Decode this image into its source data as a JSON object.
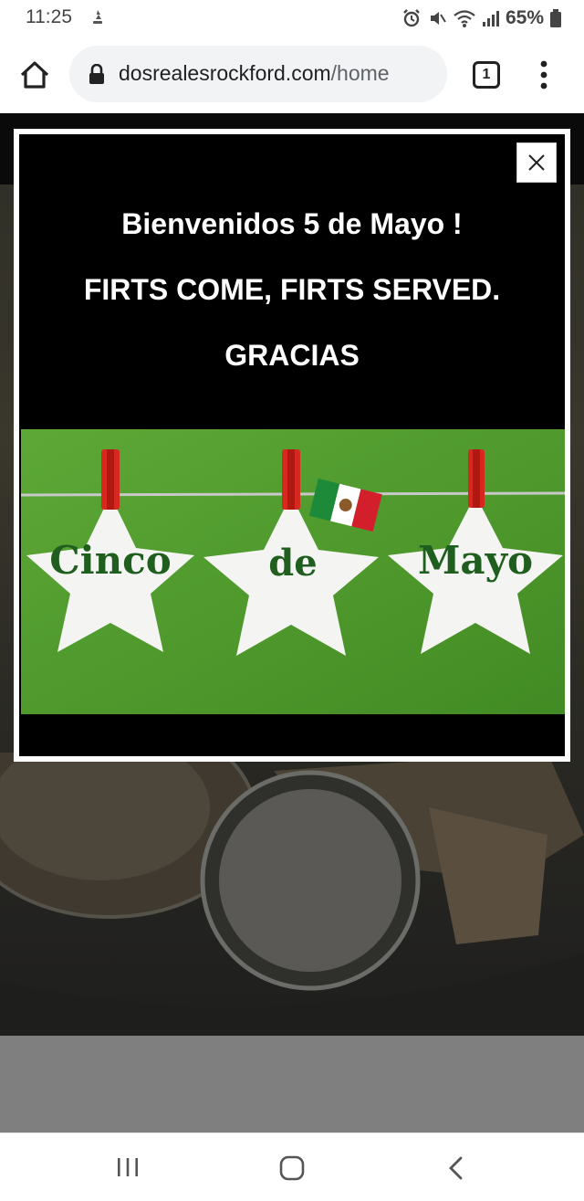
{
  "status_bar": {
    "time": "11:25",
    "battery_percent": "65%"
  },
  "browser": {
    "url_domain": "dosrealesrockford.com",
    "url_path": "/home",
    "tab_count": "1"
  },
  "modal": {
    "line1": "Bienvenidos 5 de Mayo !",
    "line2": "FIRTS COME, FIRTS SERVED.",
    "line3": "GRACIAS",
    "banner": {
      "word1": "Cinco",
      "word2": "de",
      "word3": "Mayo",
      "background_color": "#4c9a2a",
      "text_color": "#1f5e1f"
    }
  },
  "colors": {
    "modal_bg": "#000000",
    "modal_border": "#ffffff",
    "page_dim": "#2c2b26",
    "footer_grey": "#7f7f7f"
  }
}
